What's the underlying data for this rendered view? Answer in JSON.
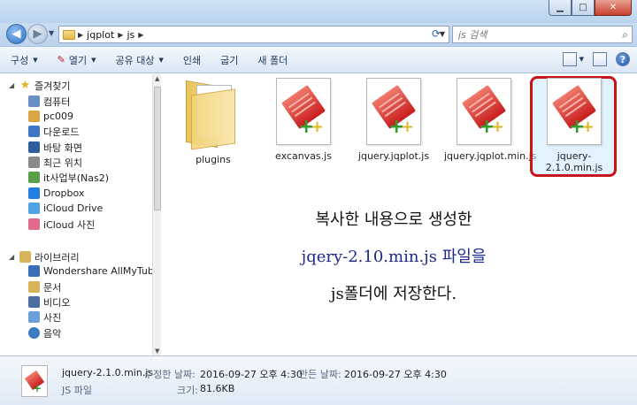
{
  "window": {
    "controls": {
      "minimize": "▁",
      "maximize": "□",
      "close": "✕"
    }
  },
  "address_bar": {
    "segments": [
      "jqplot",
      "js"
    ],
    "search_placeholder": "js 검색"
  },
  "toolbar": {
    "items": [
      {
        "label": "구성",
        "dropdown": true
      },
      {
        "label": "열기",
        "dropdown": true
      },
      {
        "label": "공유 대상",
        "dropdown": true
      },
      {
        "label": "인쇄",
        "dropdown": false
      },
      {
        "label": "굽기",
        "dropdown": false
      },
      {
        "label": "새 폴더",
        "dropdown": false
      }
    ],
    "help_label": "?"
  },
  "sidebar": {
    "favorites_label": "즐겨찾기",
    "items": [
      {
        "label": "컴퓨터",
        "icon": "computer-icon",
        "color": "#6a8fc4"
      },
      {
        "label": "pc009",
        "icon": "user-folder-icon",
        "color": "#d9a441"
      },
      {
        "label": "다운로드",
        "icon": "downloads-icon",
        "color": "#3d76c4"
      },
      {
        "label": "바탕 화면",
        "icon": "desktop-icon",
        "color": "#2f5e9e"
      },
      {
        "label": "최근 위치",
        "icon": "recent-places-icon",
        "color": "#8a8a8a"
      },
      {
        "label": "it사업부(Nas2)",
        "icon": "network-share-icon",
        "color": "#5aa04a"
      },
      {
        "label": "Dropbox",
        "icon": "dropbox-icon",
        "color": "#1f7fe0"
      },
      {
        "label": "iCloud Drive",
        "icon": "icloud-drive-icon",
        "color": "#4fa3e6"
      },
      {
        "label": "iCloud 사진",
        "icon": "icloud-photos-icon",
        "color": "#e36a8c"
      }
    ],
    "libraries_label": "라이브러리",
    "library_items": [
      {
        "label": "Wondershare AllMyTube",
        "icon": "video-library-icon",
        "color": "#3a6fb5"
      },
      {
        "label": "문서",
        "icon": "documents-icon",
        "color": "#d7b45a"
      },
      {
        "label": "비디오",
        "icon": "videos-icon",
        "color": "#4a6fa0"
      },
      {
        "label": "사진",
        "icon": "pictures-icon",
        "color": "#6aa0d8"
      },
      {
        "label": "음악",
        "icon": "music-icon",
        "color": "#3c7bbf"
      }
    ]
  },
  "files": [
    {
      "name": "plugins",
      "type": "folder"
    },
    {
      "name": "excanvas.js",
      "type": "js"
    },
    {
      "name": "jquery.jqplot.js",
      "type": "js"
    },
    {
      "name": "jquery.jqplot.min.js",
      "type": "js"
    },
    {
      "name": "jquery-2.1.0.min.js",
      "type": "js",
      "selected": true
    }
  ],
  "annotation": {
    "line1": "복사한 내용으로 생성한",
    "line2": "jqery-2.10.min.js 파일을",
    "line3": "js폴더에 저장한다."
  },
  "details": {
    "filename": "jquery-2.1.0.min.js",
    "filetype": "JS 파일",
    "modified_label": "수정한 날짜:",
    "modified_value": "2016-09-27 오후 4:30",
    "created_label": "만든 날짜:",
    "created_value": "2016-09-27 오후 4:30",
    "size_label": "크기:",
    "size_value": "81.6KB"
  },
  "colors": {
    "selection_border": "#c8141a",
    "annotation_blue": "#1d2a8a"
  }
}
